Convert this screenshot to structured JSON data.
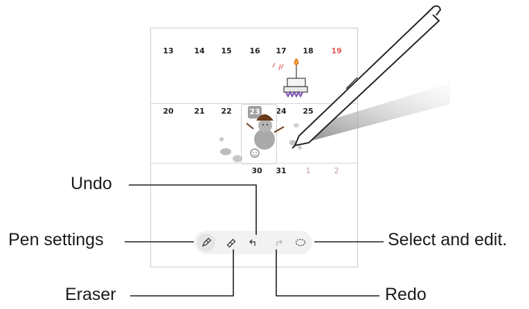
{
  "calendar": {
    "weeks": [
      {
        "days": [
          "13",
          "14",
          "15",
          "16",
          "17",
          "18",
          "19"
        ]
      },
      {
        "days": [
          "20",
          "21",
          "22",
          "23",
          "24",
          "25",
          ""
        ]
      },
      {
        "days": [
          "",
          "",
          "",
          "30",
          "31",
          "1",
          "2"
        ]
      }
    ],
    "today": "23"
  },
  "toolbar": {
    "tools": [
      {
        "name": "pen-icon"
      },
      {
        "name": "eraser-icon"
      },
      {
        "name": "undo-icon"
      },
      {
        "name": "redo-icon"
      },
      {
        "name": "lasso-select-icon"
      }
    ]
  },
  "callouts": {
    "undo": "Undo",
    "pen_settings": "Pen settings",
    "eraser": "Eraser",
    "select_edit": "Select and edit.",
    "redo": "Redo"
  },
  "colors": {
    "sunday": "#e05a5a",
    "today_bg": "#111111"
  }
}
